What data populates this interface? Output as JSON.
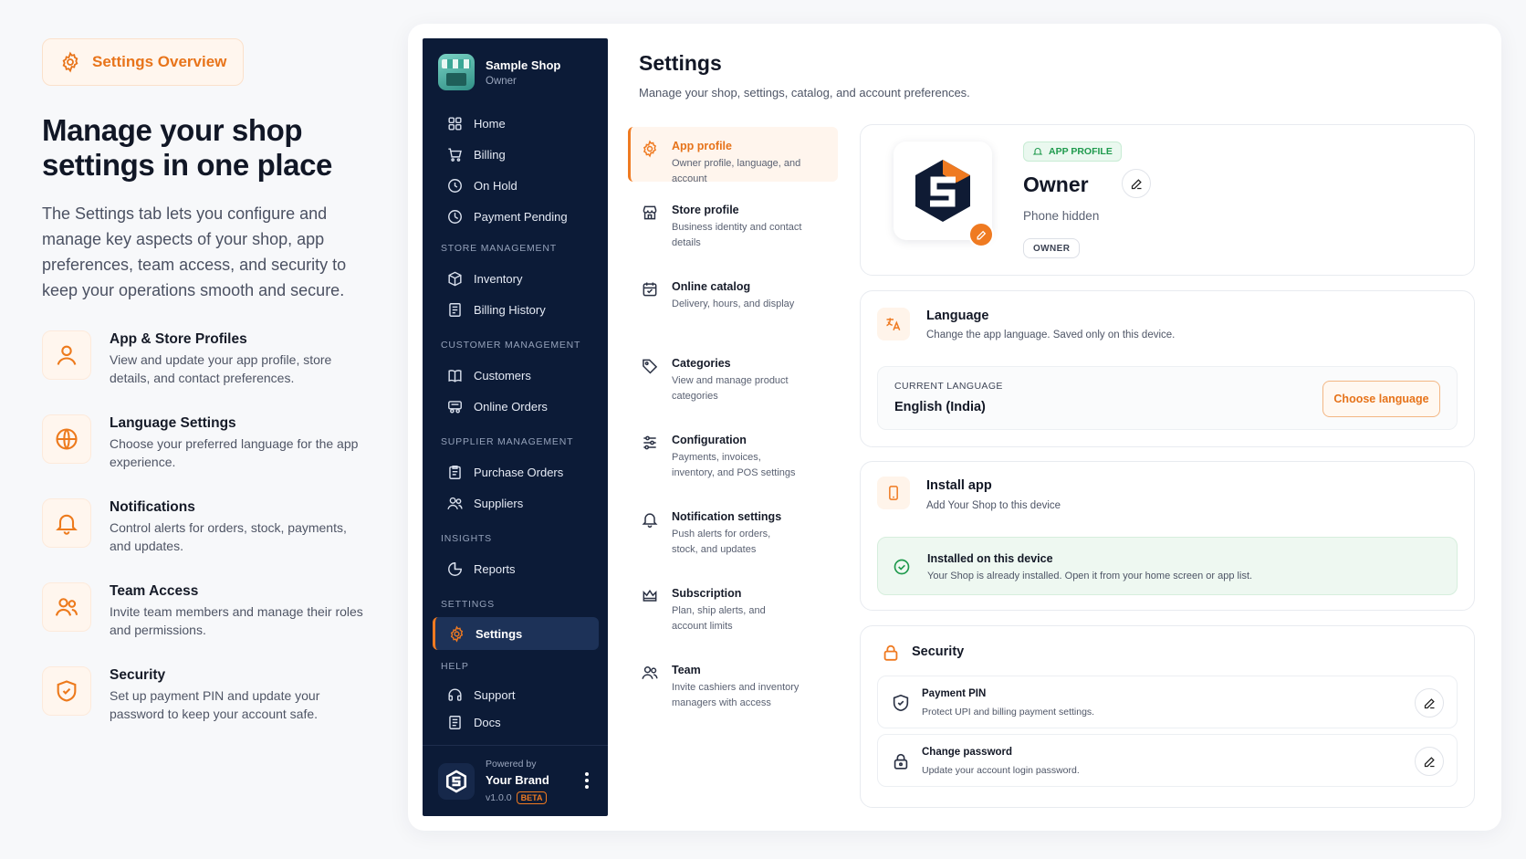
{
  "overview": {
    "pill_label": "Settings Overview",
    "headline": "Manage your shop settings in one place",
    "lead": "The Settings tab lets you configure and manage key aspects of your shop, app preferences, team access, and security to keep your operations smooth and secure.",
    "features": [
      {
        "icon": "user-icon",
        "title": "App & Store Profiles",
        "desc": "View and update your app profile, store details, and contact preferences."
      },
      {
        "icon": "globe-icon",
        "title": "Language Settings",
        "desc": "Choose your preferred language for the app experience."
      },
      {
        "icon": "bell-icon",
        "title": "Notifications",
        "desc": "Control alerts for orders, stock, payments, and updates."
      },
      {
        "icon": "users-icon",
        "title": "Team Access",
        "desc": "Invite team members and manage their roles and permissions."
      },
      {
        "icon": "shield-icon",
        "title": "Security",
        "desc": "Set up payment PIN and update your password to keep your account safe."
      }
    ]
  },
  "sidebar": {
    "shop_name": "Sample Shop",
    "shop_role": "Owner",
    "items": [
      {
        "label": "Home"
      },
      {
        "label": "Billing"
      },
      {
        "label": "On Hold"
      },
      {
        "label": "Payment Pending"
      }
    ],
    "sections": [
      {
        "title": "STORE MANAGEMENT",
        "items": [
          {
            "label": "Inventory"
          },
          {
            "label": "Billing History"
          }
        ]
      },
      {
        "title": "CUSTOMER MANAGEMENT",
        "items": [
          {
            "label": "Customers"
          },
          {
            "label": "Online Orders"
          }
        ]
      },
      {
        "title": "SUPPLIER MANAGEMENT",
        "items": [
          {
            "label": "Purchase Orders"
          },
          {
            "label": "Suppliers"
          }
        ]
      },
      {
        "title": "INSIGHTS",
        "items": [
          {
            "label": "Reports"
          }
        ]
      },
      {
        "title": "SETTINGS",
        "items": [
          {
            "label": "Settings"
          }
        ]
      },
      {
        "title": "HELP",
        "items": [
          {
            "label": "Support"
          },
          {
            "label": "Docs"
          }
        ]
      }
    ],
    "footer": {
      "powered_by": "Powered by",
      "brand": "Your Brand",
      "version": "v1.0.0",
      "badge": "BETA"
    }
  },
  "main": {
    "title": "Settings",
    "subtitle": "Manage your shop, settings, catalog, and account preferences."
  },
  "subnav": [
    {
      "title": "App profile",
      "desc": "Owner profile, language, and account"
    },
    {
      "title": "Store profile",
      "desc": "Business identity and contact details"
    },
    {
      "title": "Online catalog",
      "desc": "Delivery, hours, and display"
    },
    {
      "title": "Categories",
      "desc": "View and manage product categories"
    },
    {
      "title": "Configuration",
      "desc": "Payments, invoices, inventory, and POS settings"
    },
    {
      "title": "Notification settings",
      "desc": "Push alerts for orders, stock, and updates"
    },
    {
      "title": "Subscription",
      "desc": "Plan, ship alerts, and account limits"
    },
    {
      "title": "Team",
      "desc": "Invite cashiers and inventory managers with access"
    }
  ],
  "profile": {
    "badge": "APP PROFILE",
    "name": "Owner",
    "phone": "Phone hidden",
    "role": "OWNER"
  },
  "language": {
    "title": "Language",
    "desc": "Change the app language. Saved only on this device.",
    "current_label": "CURRENT LANGUAGE",
    "current_value": "English (India)",
    "button": "Choose language"
  },
  "install": {
    "title": "Install app",
    "desc": "Add Your Shop to this device",
    "status_title": "Installed on this device",
    "status_desc": "Your Shop is already installed. Open it from your home screen or app list."
  },
  "security": {
    "title": "Security",
    "rows": [
      {
        "title": "Payment PIN",
        "desc": "Protect UPI and billing payment settings."
      },
      {
        "title": "Change password",
        "desc": "Update your account login password."
      }
    ]
  },
  "colors": {
    "accent": "#ef7a21",
    "sidebar": "#0c1b37",
    "success": "#1f9a4d"
  }
}
